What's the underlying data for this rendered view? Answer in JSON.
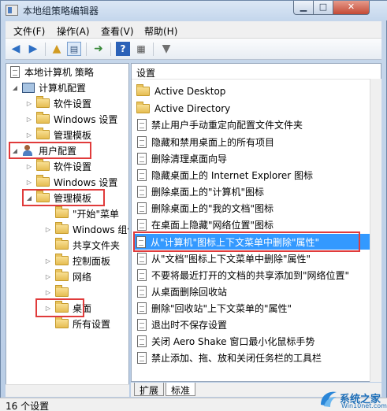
{
  "window": {
    "title": "本地组策略编辑器"
  },
  "menubar": {
    "items": [
      "文件(F)",
      "操作(A)",
      "查看(V)",
      "帮助(H)"
    ]
  },
  "toolbar": {
    "icons": [
      "back-arrow-icon",
      "forward-arrow-icon",
      "up-folder-icon",
      "show-hide-tree-icon",
      "export-list-icon",
      "help-icon",
      "properties-view-icon",
      "filter-icon"
    ]
  },
  "tree": {
    "root": "本地计算机 策略",
    "computer_config": "计算机配置",
    "cc_software": "软件设置",
    "cc_windows": "Windows 设置",
    "cc_admin": "管理模板",
    "user_config": "用户配置",
    "uc_software": "软件设置",
    "uc_windows": "Windows 设置",
    "uc_admin": "管理模板",
    "start_menu": "\"开始\"菜单",
    "windows_components": "Windows 组件",
    "shared_folders": "共享文件夹",
    "control_panel": "控制面板",
    "network": "网络",
    "desktop": "桌面",
    "all_settings": "所有设置"
  },
  "list": {
    "header": "设置",
    "items": [
      {
        "type": "folder",
        "label": "Active Desktop"
      },
      {
        "type": "folder",
        "label": "Active Directory"
      },
      {
        "type": "policy",
        "label": "禁止用户手动重定向配置文件文件夹"
      },
      {
        "type": "policy",
        "label": "隐藏和禁用桌面上的所有项目"
      },
      {
        "type": "policy",
        "label": "删除清理桌面向导"
      },
      {
        "type": "policy",
        "label": "隐藏桌面上的 Internet Explorer 图标"
      },
      {
        "type": "policy",
        "label": "删除桌面上的\"计算机\"图标"
      },
      {
        "type": "policy",
        "label": "删除桌面上的\"我的文档\"图标"
      },
      {
        "type": "policy",
        "label": "在桌面上隐藏\"网络位置\"图标"
      },
      {
        "type": "policy",
        "label": "从\"计算机\"图标上下文菜单中删除\"属性\""
      },
      {
        "type": "policy",
        "label": "从\"文档\"图标上下文菜单中删除\"属性\""
      },
      {
        "type": "policy",
        "label": "不要将最近打开的文档的共享添加到\"网络位置\""
      },
      {
        "type": "policy",
        "label": "从桌面删除回收站"
      },
      {
        "type": "policy",
        "label": "删除\"回收站\"上下文菜单的\"属性\""
      },
      {
        "type": "policy",
        "label": "退出时不保存设置"
      },
      {
        "type": "policy",
        "label": "关闭 Aero Shake 窗口最小化鼠标手势"
      },
      {
        "type": "policy",
        "label": "禁止添加、拖、放和关闭任务栏的工具栏"
      }
    ]
  },
  "tabs": {
    "extended": "扩展",
    "standard": "标准"
  },
  "statusbar": {
    "text": "16 个设置"
  },
  "watermark": {
    "text": "系统之家",
    "sub": "Win10net.com"
  },
  "colors": {
    "highlight": "#e03b3b",
    "selection": "#3399ff"
  }
}
